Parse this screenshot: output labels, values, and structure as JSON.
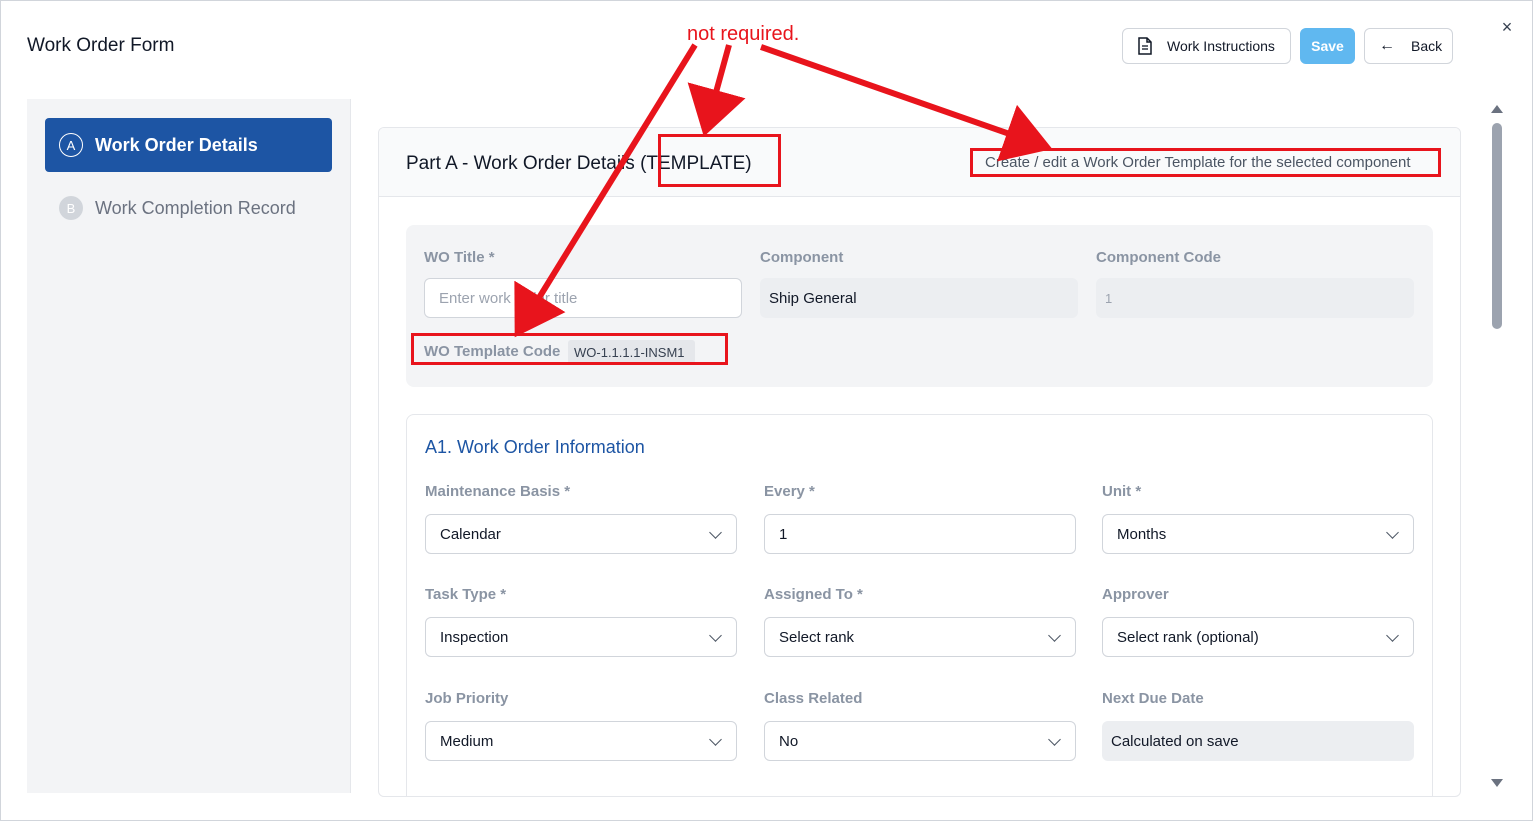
{
  "window": {
    "title": "Work Order Form",
    "close_icon": "×"
  },
  "toolbar": {
    "work_instructions_label": "Work Instructions",
    "save_label": "Save",
    "back_label": "Back",
    "back_arrow": "←"
  },
  "sidebar": {
    "steps": [
      {
        "badge": "A",
        "label": "Work Order Details",
        "active": true
      },
      {
        "badge": "B",
        "label": "Work Completion Record",
        "active": false
      }
    ]
  },
  "part_a": {
    "title": "Part A - Work Order Details",
    "title_suffix": "(TEMPLATE)",
    "subtitle": "Create / edit a Work Order Template for the selected component",
    "wo_title_label": "WO Title *",
    "wo_title_placeholder": "Enter work order title",
    "component_label": "Component",
    "component_value": "Ship General",
    "component_code_label": "Component Code",
    "component_code_value": "1",
    "template_code_label": "WO Template Code",
    "template_code_value": "WO-1.1.1.1-INSM1"
  },
  "a1": {
    "title": "A1. Work Order Information",
    "fields": {
      "maintenance_basis": {
        "label": "Maintenance Basis *",
        "value": "Calendar"
      },
      "every": {
        "label": "Every *",
        "value": "1"
      },
      "unit": {
        "label": "Unit *",
        "value": "Months"
      },
      "task_type": {
        "label": "Task Type *",
        "value": "Inspection"
      },
      "assigned_to": {
        "label": "Assigned To *",
        "value": "Select rank"
      },
      "approver": {
        "label": "Approver",
        "value": "Select rank (optional)"
      },
      "job_priority": {
        "label": "Job Priority",
        "value": "Medium"
      },
      "class_related": {
        "label": "Class Related",
        "value": "No"
      },
      "next_due_date": {
        "label": "Next Due Date",
        "value": "Calculated on save"
      }
    }
  },
  "annotation": {
    "text": "not required.",
    "color": "#e8141c"
  },
  "colors": {
    "primary": "#1d55a4",
    "save": "#60b8f0",
    "annotation": "#e8141c"
  },
  "icons": {
    "document": "document-icon",
    "back": "arrow-left-icon",
    "close": "close-icon",
    "chevron": "chevron-down-icon"
  }
}
